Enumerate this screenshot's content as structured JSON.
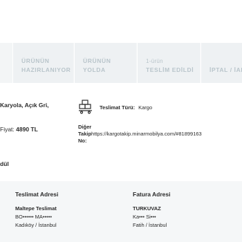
{
  "tabs": [
    {
      "num": "",
      "line1": "ÜRÜNÜN",
      "line2": "HAZIRLANIYOR"
    },
    {
      "num": "",
      "line1": "ÜRÜNÜN",
      "line2": "YOLDA"
    },
    {
      "num": "1-ürün",
      "line1": "",
      "line2": "TESLİM EDİLDİ"
    },
    {
      "num": "",
      "line1": "",
      "line2": "İPTAL / İADE"
    }
  ],
  "product": {
    "name": "Karyola, Açık Gri,",
    "price_label": "Fiyat:",
    "price_value": "4890 TL"
  },
  "shipping": {
    "type_label": "Teslimat Türü:",
    "type_value": "Kargo",
    "track_label_1": "Diğer",
    "track_label_2": "Takip",
    "track_url": "https://kargotakip.minarmobilya.com/#81899163",
    "track_label_3": "No:"
  },
  "section_label": "dül",
  "delivery_address": {
    "title": "Teslimat Adresi",
    "name": "Maltepe Teslimat",
    "line1": "BO•••••• MA•••••",
    "line2": "Kadıköy / İstanbul"
  },
  "billing_address": {
    "title": "Fatura Adresi",
    "name": "TURKUVAZ",
    "line1": "Ka••• Si•••",
    "line2": "Fatih / İstanbul"
  },
  "icons": {
    "shipping": "delivery-boxes-icon"
  },
  "colors": {
    "tab_bg": "#eef1f3",
    "tab_text": "#b9c5cb",
    "panel_bg": "#f5f7f8"
  }
}
